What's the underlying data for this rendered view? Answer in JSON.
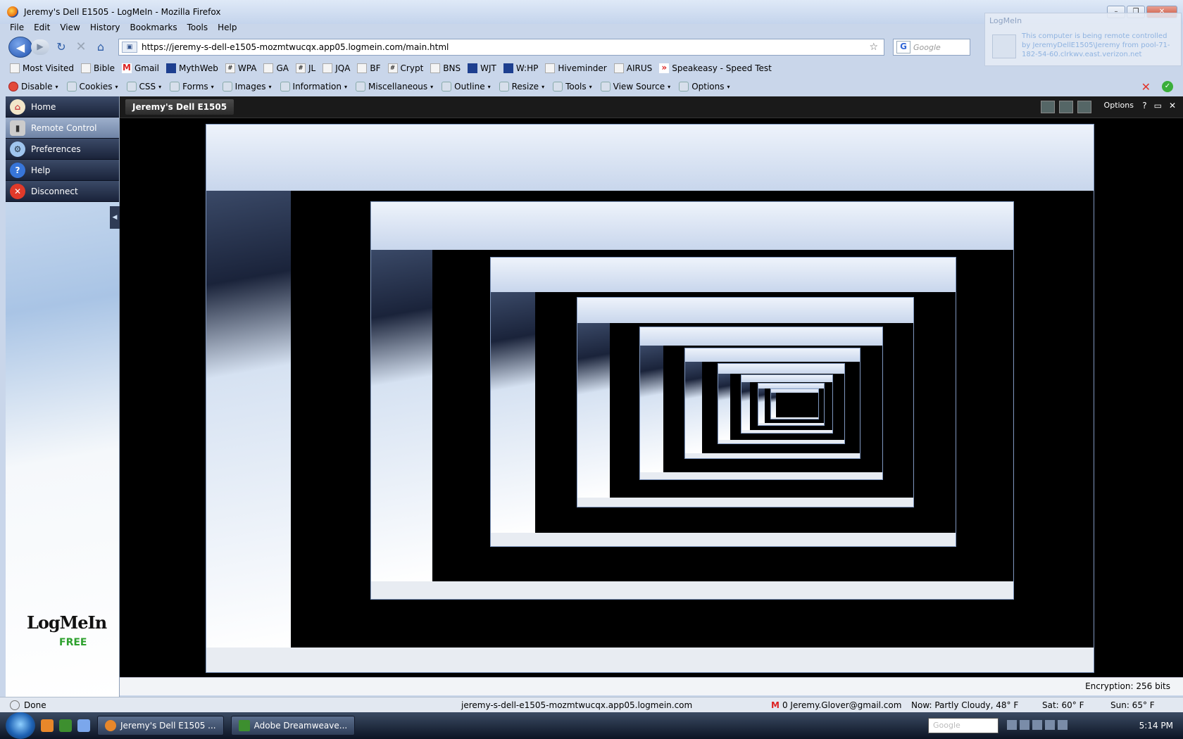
{
  "window": {
    "title": "Jeremy's Dell E1505 - LogMeIn - Mozilla Firefox"
  },
  "menu": [
    "File",
    "Edit",
    "View",
    "History",
    "Bookmarks",
    "Tools",
    "Help"
  ],
  "nav": {
    "url": "https://jeremy-s-dell-e1505-mozmtwucqx.app05.logmein.com/main.html",
    "search_placeholder": "Google"
  },
  "bookmarks": [
    "Most Visited",
    "Bible",
    "Gmail",
    "MythWeb",
    "WPA",
    "GA",
    "JL",
    "JQA",
    "BF",
    "Crypt",
    "BNS",
    "WJT",
    "W:HP",
    "Hiveminder",
    "AIRUS",
    "Speakeasy - Speed Test"
  ],
  "devbar": [
    "Disable",
    "Cookies",
    "CSS",
    "Forms",
    "Images",
    "Information",
    "Miscellaneous",
    "Outline",
    "Resize",
    "Tools",
    "View Source",
    "Options"
  ],
  "notification": {
    "title": "LogMeIn",
    "message": "This computer is being remote controlled by JeremyDellE1505\\Jeremy from pool-71-182-54-60.clrkwv.east.verizon.net"
  },
  "sidebar": {
    "items": [
      {
        "label": "Home",
        "icon": "home-icon"
      },
      {
        "label": "Remote Control",
        "icon": "remote-control-icon"
      },
      {
        "label": "Preferences",
        "icon": "preferences-icon"
      },
      {
        "label": "Help",
        "icon": "help-icon"
      },
      {
        "label": "Disconnect",
        "icon": "disconnect-icon"
      }
    ],
    "logo": "LogMeIn",
    "free": "FREE"
  },
  "remote": {
    "title": "Jeremy's Dell E1505",
    "options_label": "Options",
    "encryption": "Encryption: 256 bits"
  },
  "status": {
    "done": "Done",
    "host": "jeremy-s-dell-e1505-mozmtwucqx.app05.logmein.com",
    "gmail": "0 Jeremy.Glover@gmail.com",
    "weather_now": "Now: Partly Cloudy, 48° F",
    "weather_sat": "Sat: 60° F",
    "weather_sun": "Sun: 65° F"
  },
  "taskbar": {
    "buttons": [
      "Jeremy's Dell E1505 ...",
      "Adobe Dreamweave..."
    ],
    "search_placeholder": "Google",
    "clock": "5:14 PM"
  }
}
